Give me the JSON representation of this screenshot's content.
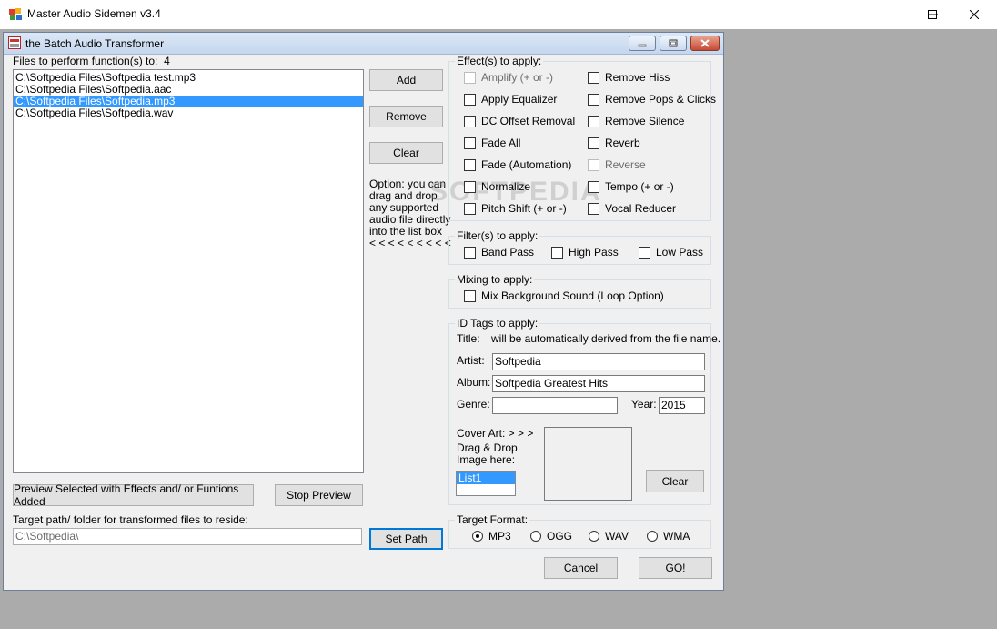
{
  "window": {
    "title": "Master Audio Sidemen v3.4",
    "minimize_label": "—",
    "maximize_label": "☐",
    "close_label": "✕"
  },
  "inner_window": {
    "title": "the Batch Audio Transformer"
  },
  "files": {
    "label": "Files to perform function(s) to:",
    "count": "4",
    "items": [
      {
        "path": "C:\\Softpedia Files\\Softpedia test.mp3",
        "selected": false
      },
      {
        "path": "C:\\Softpedia Files\\Softpedia.aac",
        "selected": false
      },
      {
        "path": "C:\\Softpedia Files\\Softpedia.mp3",
        "selected": true
      },
      {
        "path": "C:\\Softpedia Files\\Softpedia.wav",
        "selected": false
      }
    ]
  },
  "buttons": {
    "add": "Add",
    "remove": "Remove",
    "clear": "Clear",
    "preview_selected": "Preview Selected with Effects and/ or Funtions Added",
    "stop_preview": "Stop Preview",
    "set_path": "Set Path",
    "cover_clear": "Clear",
    "cancel": "Cancel",
    "go": "GO!"
  },
  "option_note": [
    "Option: you can",
    "drag and drop",
    "any supported",
    "audio file directly",
    "into the list box",
    "< < < < < < < < <"
  ],
  "effects": {
    "title": "Effect(s) to apply:",
    "left": [
      {
        "label": "Amplify (+ or -)",
        "disabled": true
      },
      {
        "label": "Apply Equalizer",
        "disabled": false
      },
      {
        "label": "DC Offset Removal",
        "disabled": false
      },
      {
        "label": "Fade All",
        "disabled": false
      },
      {
        "label": "Fade (Automation)",
        "disabled": false
      },
      {
        "label": "Normalize",
        "disabled": false
      },
      {
        "label": "Pitch Shift (+ or -)",
        "disabled": false
      }
    ],
    "right": [
      {
        "label": "Remove Hiss",
        "disabled": false
      },
      {
        "label": "Remove Pops & Clicks",
        "disabled": false
      },
      {
        "label": "Remove Silence",
        "disabled": false
      },
      {
        "label": "Reverb",
        "disabled": false
      },
      {
        "label": "Reverse",
        "disabled": true
      },
      {
        "label": "Tempo (+ or -)",
        "disabled": false
      },
      {
        "label": "Vocal Reducer",
        "disabled": false
      }
    ]
  },
  "filters": {
    "title": "Filter(s) to apply:",
    "items": [
      "Band Pass",
      "High Pass",
      "Low Pass"
    ]
  },
  "mixing": {
    "title": "Mixing to apply:",
    "item": "Mix Background Sound (Loop Option)"
  },
  "id_tags": {
    "title": "ID Tags to apply:",
    "title_label": "Title:",
    "title_note": "will be automatically derived from the file name.",
    "artist_label": "Artist:",
    "artist_value": "Softpedia",
    "album_label": "Album:",
    "album_value": "Softpedia Greatest Hits",
    "genre_label": "Genre:",
    "genre_value": "",
    "year_label": "Year:",
    "year_value": "2015",
    "cover_label": "Cover Art:  > > >",
    "drag_label_1": "Drag & Drop",
    "drag_label_2": "Image here:",
    "cover_list_item": "List1"
  },
  "target_path": {
    "label": "Target path/ folder for transformed files to reside:",
    "value": "C:\\Softpedia\\"
  },
  "target_format": {
    "title": "Target Format:",
    "options": [
      "MP3",
      "OGG",
      "WAV",
      "WMA"
    ],
    "selected": "MP3"
  },
  "watermark": "SOFTPEDIA"
}
